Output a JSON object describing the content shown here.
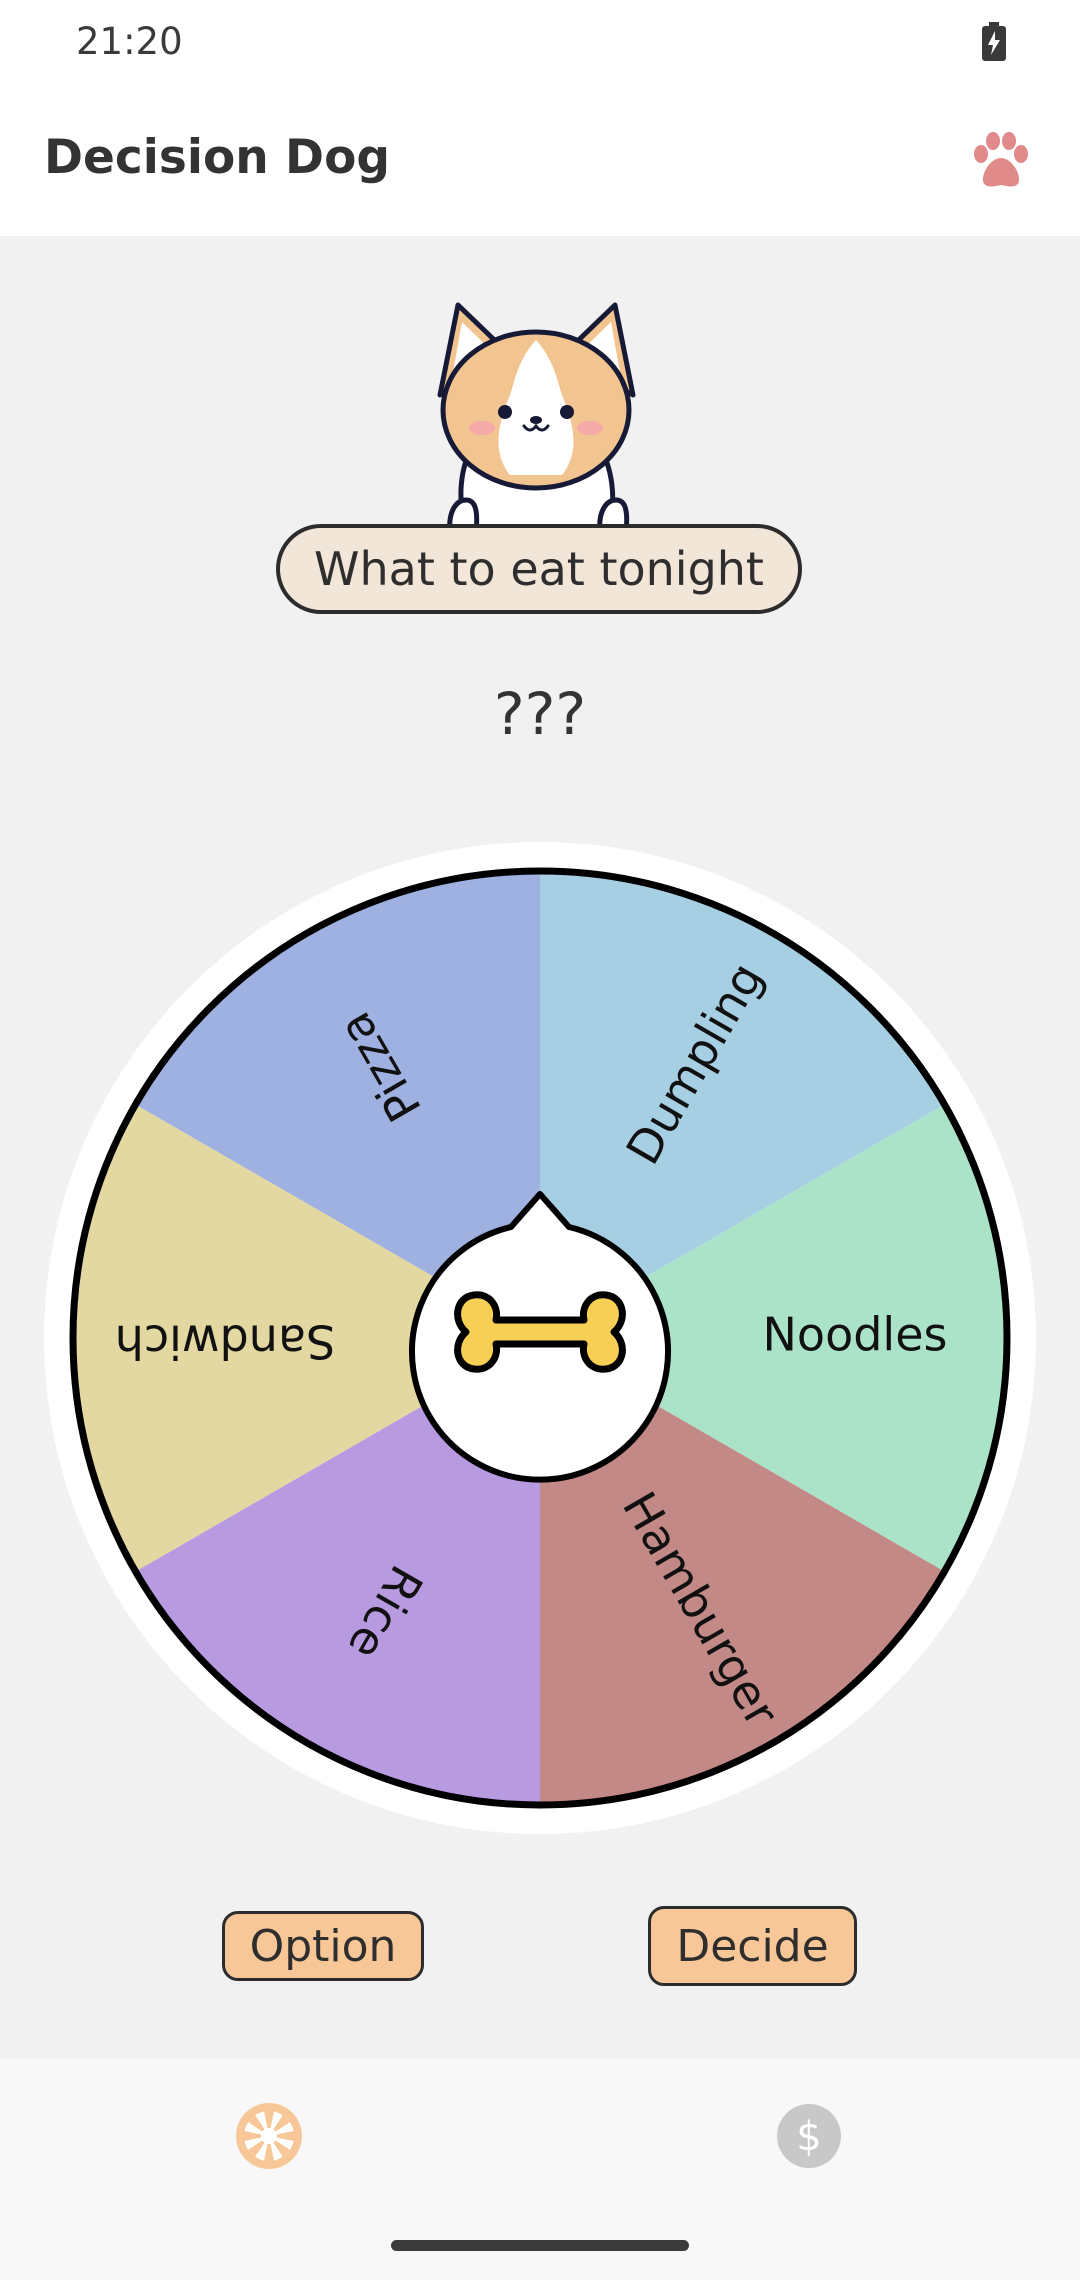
{
  "status_bar": {
    "time": "21:20",
    "battery_icon": "battery-charging-icon"
  },
  "app_bar": {
    "title": "Decision Dog",
    "action_icon": "paw-icon",
    "accent": "#e08a8a"
  },
  "question": "What to eat tonight",
  "result": "???",
  "wheel": {
    "segments": [
      {
        "label": "Dumpling",
        "color": "#a7cfe4"
      },
      {
        "label": "Noodles",
        "color": "#abe3c9"
      },
      {
        "label": "Hamburger",
        "color": "#c28986"
      },
      {
        "label": "Rice",
        "color": "#b89ae0"
      },
      {
        "label": "Sandwich",
        "color": "#e3d8a2"
      },
      {
        "label": "Pizza",
        "color": "#9fb1e0"
      }
    ],
    "center_icon": "bone-icon"
  },
  "buttons": {
    "option": "Option",
    "decide": "Decide"
  },
  "bottom_nav": [
    {
      "name": "wheel-icon",
      "active": true,
      "color": "#f7c797"
    },
    {
      "name": "dollar-icon",
      "active": false,
      "color": "#c8c8c8"
    }
  ]
}
